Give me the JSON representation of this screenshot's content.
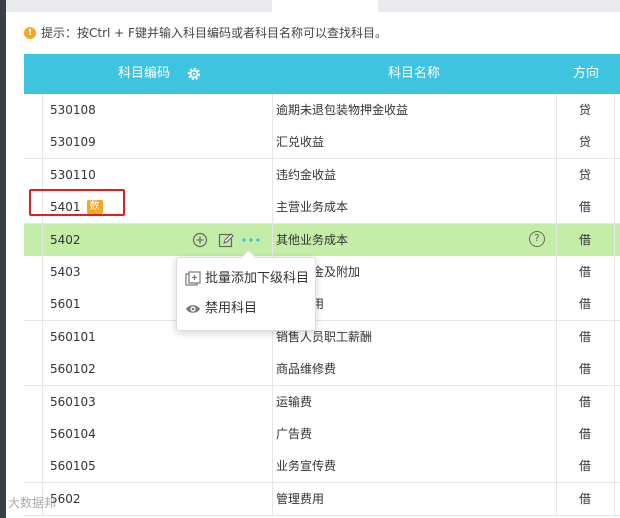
{
  "tip": {
    "icon": "info-icon",
    "text": "提示：按Ctrl + F键并输入科目编码或者科目名称可以查找科目。"
  },
  "header": {
    "code": "科目编码",
    "name": "科目名称",
    "direction": "方向",
    "settings_icon": "gear-icon"
  },
  "rows": [
    {
      "code": "530108",
      "name": "逾期未退包装物押金收益",
      "direction": "贷"
    },
    {
      "code": "530109",
      "name": "汇兑收益",
      "direction": "贷"
    },
    {
      "code": "530110",
      "name": "违约金收益",
      "direction": "贷"
    },
    {
      "code": "5401",
      "badge": "数",
      "name": "主营业务成本",
      "direction": "借"
    },
    {
      "code": "5402",
      "name": "其他业务成本",
      "direction": "借"
    },
    {
      "code": "5403",
      "name": "营业税金及附加",
      "direction": "借"
    },
    {
      "code": "5601",
      "name": "销售费用",
      "direction": "借"
    },
    {
      "code": "560101",
      "name": "销售人员职工薪酬",
      "direction": "借"
    },
    {
      "code": "560102",
      "name": "商品维修费",
      "direction": "借"
    },
    {
      "code": "560103",
      "name": "运输费",
      "direction": "借"
    },
    {
      "code": "560104",
      "name": "广告费",
      "direction": "借"
    },
    {
      "code": "560105",
      "name": "业务宣传费",
      "direction": "借"
    },
    {
      "code": "5602",
      "name": "管理费用",
      "direction": "借"
    }
  ],
  "row_actions": {
    "add_icon": "plus-circle-icon",
    "edit_icon": "edit-icon",
    "more_icon": "ellipsis-icon",
    "help_icon": "question-circle-icon",
    "help_text": "?"
  },
  "menu": {
    "items": [
      {
        "label": "批量添加下级科目",
        "icon": "add-sub-icon"
      },
      {
        "label": "禁用科目",
        "icon": "eye-icon"
      }
    ]
  },
  "watermark": "大数据邦",
  "colors": {
    "header_bg": "#3ec4de",
    "highlight_row": "#c4eea8",
    "badge": "#f5a623",
    "annotation_box": "#e02020",
    "more_dots": "#3ec4de"
  }
}
